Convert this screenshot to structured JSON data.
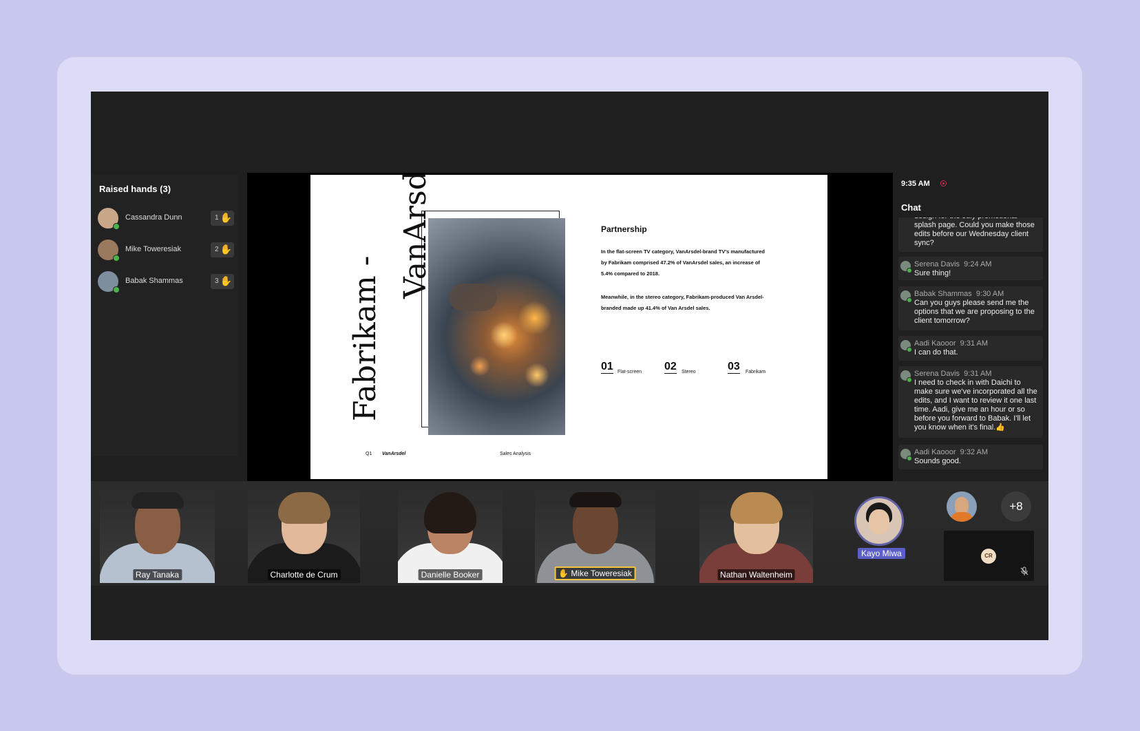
{
  "raised_hands": {
    "title": "Raised hands (3)",
    "people": [
      {
        "name": "Cassandra Dunn",
        "order": "1"
      },
      {
        "name": "Mike Toweresiak",
        "order": "2"
      },
      {
        "name": "Babak Shammas",
        "order": "3"
      }
    ]
  },
  "slide": {
    "title_line1": "Fabrikam -",
    "title_line2": "VanArsdel",
    "heading": "Partnership",
    "para1": "In the flat-screen TV category, VanArsdel-brand TV's manufactured by Fabrikam comprised 47.2% of VanArsdel sales, an increase of 5.4% compared to 2018.",
    "para2": "Meanwhile, in the stereo category, Fabrikam-produced Van Arsdel-branded made up 41.4% of Van Arsdel sales.",
    "items": [
      {
        "num": "01",
        "label": "Flat-screen"
      },
      {
        "num": "02",
        "label": "Stereo"
      },
      {
        "num": "03",
        "label": "Fabrikam"
      }
    ],
    "footer_q": "Q1",
    "footer_brand": "VanArsdel",
    "footer_label": "Sales Analysis"
  },
  "chat": {
    "time": "9:35 AM",
    "title": "Chat",
    "messages": [
      {
        "author": "",
        "time": "",
        "text": "design for the July promotional splash page. Could you make those edits before our Wednesday client sync?"
      },
      {
        "author": "Serena Davis",
        "time": "9:24 AM",
        "text": "Sure thing!"
      },
      {
        "author": "Babak Shammas",
        "time": "9:30 AM",
        "text": "Can you guys please send me the options that we are proposing to the client tomorrow?"
      },
      {
        "author": "Aadi Kaooor",
        "time": "9:31 AM",
        "text": "I can do that."
      },
      {
        "author": "Serena Davis",
        "time": "9:31 AM",
        "text": "I need to check in with Daichi to make sure we've incorporated all the edits, and I want to review it one last time. Aadi, give me an hour or so before you forward to Babak. I'll let you know when it's final.👍"
      },
      {
        "author": "Aadi Kaooor",
        "time": "9:32 AM",
        "text": "Sounds good."
      }
    ]
  },
  "gallery": {
    "participants": [
      {
        "name": "Ray Tanaka"
      },
      {
        "name": "Charlotte de Crum"
      },
      {
        "name": "Danielle Booker"
      },
      {
        "name": "Mike Toweresiak"
      },
      {
        "name": "Nathan Waltenheim"
      }
    ],
    "active_speaker": "Kayo Miwa",
    "overflow_count": "+8",
    "initials_tile": "CR"
  },
  "colors": {
    "accent": "#5b5fc7",
    "hand": "#f7c33c",
    "presence": "#4cb34c",
    "recording": "#c4314b"
  }
}
